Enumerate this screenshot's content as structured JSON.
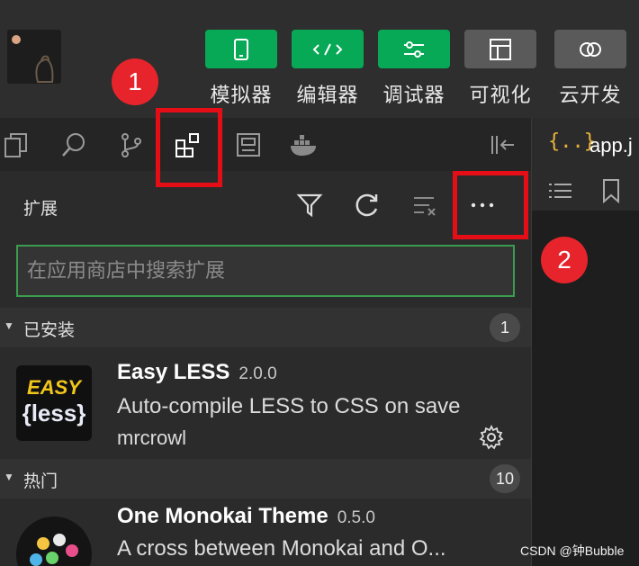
{
  "toolbar": {
    "buttons": [
      {
        "label": "模拟器",
        "icon": "phone-icon",
        "style": "green"
      },
      {
        "label": "编辑器",
        "icon": "code-icon",
        "style": "green"
      },
      {
        "label": "调试器",
        "icon": "sliders-icon",
        "style": "green"
      },
      {
        "label": "可视化",
        "icon": "layout-icon",
        "style": "gray"
      },
      {
        "label": "云开发",
        "icon": "cloud-icon",
        "style": "gray"
      }
    ]
  },
  "callouts": {
    "one": "1",
    "two": "2"
  },
  "activity_bar": {
    "icons": [
      "files-icon",
      "search-icon",
      "source-control-icon",
      "extensions-icon",
      "save-icon",
      "docker-icon",
      "collapse-panel-icon"
    ]
  },
  "editor": {
    "tab_icon_text": "{..}",
    "tab_name": "app.j"
  },
  "extensions_panel": {
    "title": "扩展",
    "actions": [
      "filter-icon",
      "refresh-icon",
      "clear-icon",
      "more-icon"
    ],
    "search_placeholder": "在应用商店中搜索扩展",
    "sections": {
      "installed": {
        "title": "已安装",
        "count": "1",
        "items": [
          {
            "name": "Easy LESS",
            "version": "2.0.0",
            "description": "Auto-compile LESS to CSS on save",
            "author": "mrcrowl",
            "logo_top": "EASY",
            "logo_bottom": "{less}"
          }
        ]
      },
      "popular": {
        "title": "热门",
        "count": "10",
        "items": [
          {
            "name": "One Monokai Theme",
            "version": "0.5.0",
            "description": "A cross between Monokai and O..."
          }
        ]
      }
    }
  },
  "watermark": "CSDN @钟Bubble",
  "colors": {
    "accent_green": "#07a856",
    "highlight_red": "#e60e16",
    "badge_red": "#e7242b",
    "search_border": "#3a9c4e"
  }
}
